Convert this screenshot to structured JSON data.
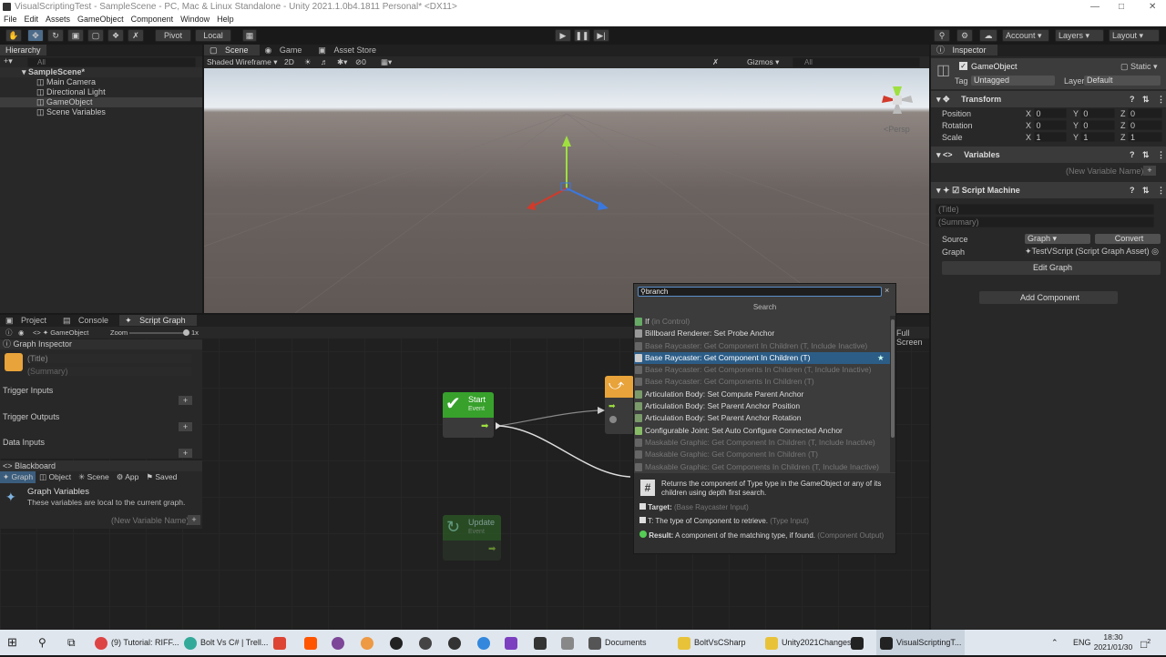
{
  "window": {
    "title": "VisualScriptingTest - SampleScene - PC, Mac & Linux Standalone - Unity 2021.1.0b4.1811 Personal* <DX11>"
  },
  "menu": [
    "File",
    "Edit",
    "Assets",
    "GameObject",
    "Component",
    "Window",
    "Help"
  ],
  "toolbar": {
    "pivot": "Pivot",
    "local": "Local",
    "account": "Account",
    "layers": "Layers",
    "layout": "Layout"
  },
  "hierarchy": {
    "tab": "Hierarchy",
    "search_placeholder": "All",
    "scene": "SampleScene*",
    "items": [
      "Main Camera",
      "Directional Light",
      "GameObject",
      "Scene Variables"
    ]
  },
  "scene_tabs": {
    "scene": "Scene",
    "game": "Game",
    "asset_store": "Asset Store",
    "shading": "Shaded Wireframe",
    "mode_2d": "2D",
    "gizmos": "Gizmos",
    "search_placeholder": "All",
    "persp": "<Persp",
    "count": "0"
  },
  "inspector": {
    "tab": "Inspector",
    "object_name": "GameObject",
    "static_label": "Static",
    "tag_label": "Tag",
    "tag_value": "Untagged",
    "layer_label": "Layer",
    "layer_value": "Default",
    "transform": {
      "title": "Transform",
      "position": "Position",
      "rotation": "Rotation",
      "scale": "Scale",
      "pos": [
        "0",
        "0",
        "0"
      ],
      "rot": [
        "0",
        "0",
        "0"
      ],
      "scl": [
        "1",
        "1",
        "1"
      ]
    },
    "variables": {
      "title": "Variables",
      "new_placeholder": "(New Variable Name)"
    },
    "script_machine": {
      "title": "Script Machine",
      "title_placeholder": "(Title)",
      "summary_placeholder": "(Summary)",
      "source_label": "Source",
      "source_value": "Graph",
      "convert": "Convert",
      "graph_label": "Graph",
      "graph_value": "TestVScript (Script Graph Asset)",
      "edit_graph": "Edit Graph"
    },
    "add_component": "Add Component"
  },
  "bottom_tabs": {
    "project": "Project",
    "console": "Console",
    "script_graph": "Script Graph",
    "gameobject": "GameObject",
    "zoom": "Zoom",
    "zoom_value": "1x",
    "full_screen": "Full Screen"
  },
  "graph_inspector": {
    "title": "Graph Inspector",
    "title_placeholder": "(Title)",
    "summary_placeholder": "(Summary)",
    "trigger_inputs": "Trigger Inputs",
    "trigger_outputs": "Trigger Outputs",
    "data_inputs": "Data Inputs"
  },
  "blackboard": {
    "title": "Blackboard",
    "tabs": [
      "Graph",
      "Object",
      "Scene",
      "App",
      "Saved"
    ],
    "heading": "Graph Variables",
    "desc": "These variables are local to the current graph.",
    "new_placeholder": "(New Variable Name)"
  },
  "nodes": {
    "start": {
      "title": "Start",
      "sub": "Event"
    },
    "update": {
      "title": "Update",
      "sub": "Event"
    }
  },
  "fuzzy": {
    "query": "branch",
    "header": "Search",
    "items": [
      {
        "label": "If",
        "suffix": "(in Control)",
        "state": "normal"
      },
      {
        "label": "Billboard Renderer: Set Probe Anchor",
        "state": "normal"
      },
      {
        "label": "Base Raycaster: Get Component In Children (T, Include Inactive)",
        "state": "dim"
      },
      {
        "label": "Base Raycaster: Get Component In Children (T)",
        "state": "selected"
      },
      {
        "label": "Base Raycaster: Get Components In Children (T, Include Inactive)",
        "state": "dim"
      },
      {
        "label": "Base Raycaster: Get Components In Children (T)",
        "state": "dim"
      },
      {
        "label": "Articulation Body: Set Compute Parent Anchor",
        "state": "normal"
      },
      {
        "label": "Articulation Body: Set Parent Anchor Position",
        "state": "normal"
      },
      {
        "label": "Articulation Body: Set Parent Anchor Rotation",
        "state": "normal"
      },
      {
        "label": "Configurable Joint: Set Auto Configure Connected Anchor",
        "state": "normal"
      },
      {
        "label": "Maskable Graphic: Get Component In Children (T, Include Inactive)",
        "state": "dim"
      },
      {
        "label": "Maskable Graphic: Get Component In Children (T)",
        "state": "dim"
      },
      {
        "label": "Maskable Graphic: Get Components In Children (T, Include Inactive)",
        "state": "dim"
      }
    ],
    "desc": "Returns the component of Type type in the GameObject or any of its children using depth first search.",
    "target_label": "Target:",
    "target_type": "(Base Raycaster Input)",
    "t_label": "T: The type of Component to retrieve.",
    "t_type": "(Type Input)",
    "result_label": "Result:",
    "result_desc": "A component of the matching type, if found.",
    "result_type": "(Component Output)"
  },
  "taskbar": {
    "items": [
      "(9) Tutorial: RIFF...",
      "Bolt Vs C# | Trell...",
      "Documents",
      "BoltVsCSharp",
      "Unity2021Changes",
      "VisualScriptingT..."
    ],
    "lang": "ENG",
    "time": "18:30",
    "date": "2021/01/30",
    "notif": "2"
  }
}
